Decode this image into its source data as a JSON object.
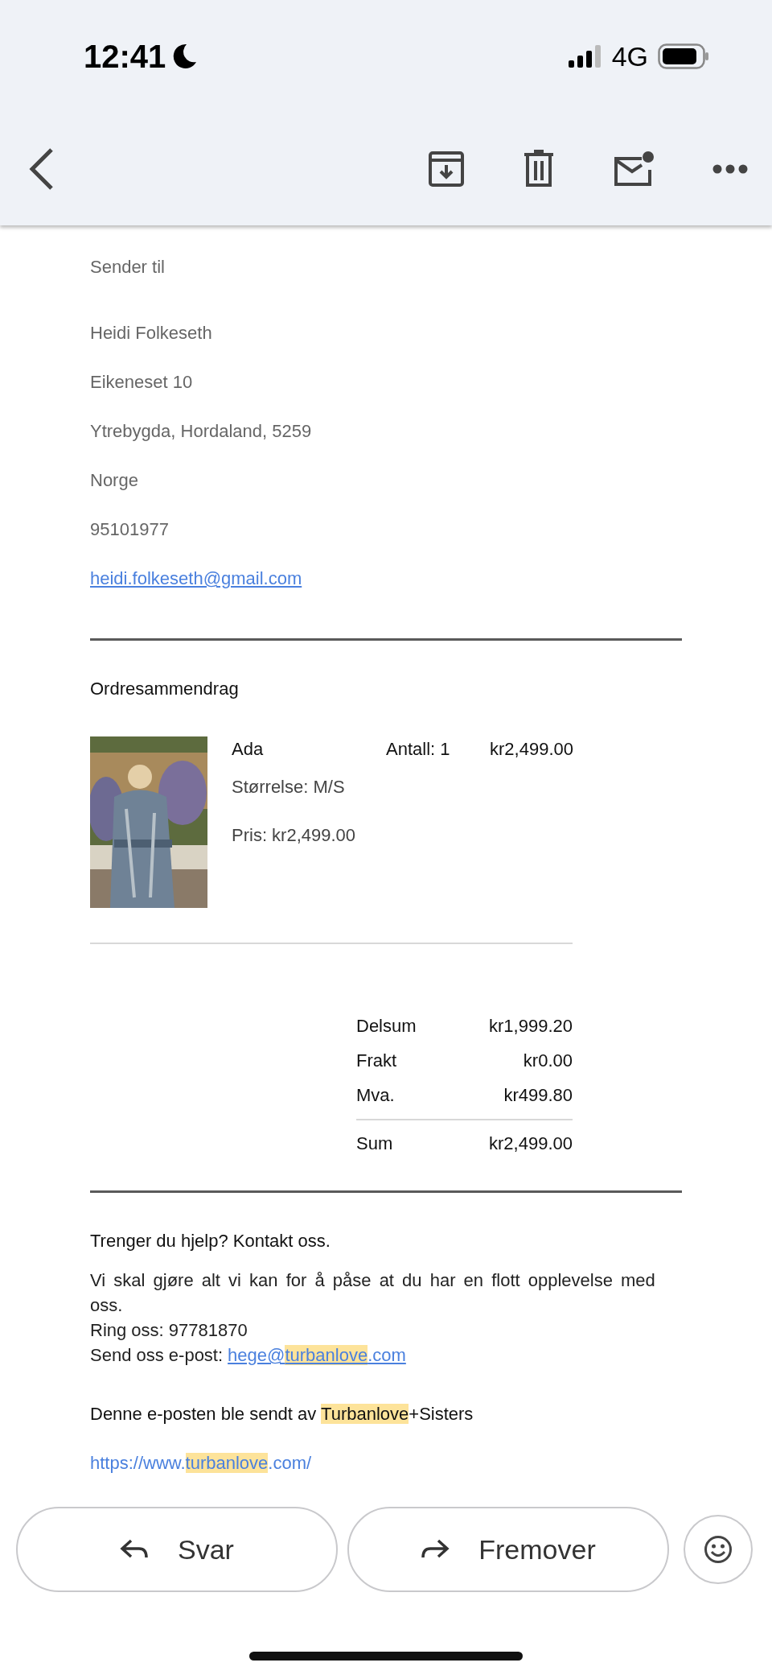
{
  "status_bar": {
    "time": "12:41",
    "network": "4G"
  },
  "recipient": {
    "heading": "Sender til",
    "lines": [
      "Heidi Folkeseth",
      "Eikeneset 10",
      "Ytrebygda, Hordaland, 5259",
      "Norge",
      "95101977"
    ],
    "email": "heidi.folkeseth@gmail.com"
  },
  "order": {
    "heading": "Ordresammendrag",
    "items": [
      {
        "name": "Ada",
        "quantity": "Antall: 1",
        "price": "kr2,499.00",
        "size": "Størrelse: M/S",
        "unit_price": "Pris: kr2,499.00"
      }
    ],
    "totals": [
      {
        "label": "Delsum",
        "value": "kr1,999.20",
        "kind": "line"
      },
      {
        "label": "Frakt",
        "value": "kr0.00",
        "kind": "line"
      },
      {
        "label": "Mva.",
        "value": "kr499.80",
        "kind": "line"
      },
      {
        "label": "Sum",
        "value": "kr2,499.00",
        "kind": "total"
      }
    ]
  },
  "contact": {
    "heading": "Trenger du hjelp? Kontakt oss.",
    "paragraph": "Vi skal gjøre alt vi kan for å påse at du har en flott opplevelse med oss.",
    "phone": "Ring oss: 97781870",
    "email_label": "Send oss e-post:",
    "email": [
      {
        "text": "hege@",
        "highlight": false
      },
      {
        "text": "turbanlove",
        "highlight": true
      },
      {
        "text": ".com",
        "highlight": false
      }
    ],
    "sender": [
      {
        "text": "Denne e-posten ble sendt av ",
        "highlight": false
      },
      {
        "text": "Turbanlove",
        "highlight": true
      },
      {
        "text": "+Sisters",
        "highlight": false
      }
    ],
    "url": [
      {
        "text": "https://www.",
        "highlight": false
      },
      {
        "text": "turbanlove",
        "highlight": true
      },
      {
        "text": ".com/",
        "highlight": false
      }
    ]
  },
  "actions": [
    {
      "label": "Svar",
      "kind": "reply"
    },
    {
      "label": "Fremover",
      "kind": "forward"
    }
  ]
}
